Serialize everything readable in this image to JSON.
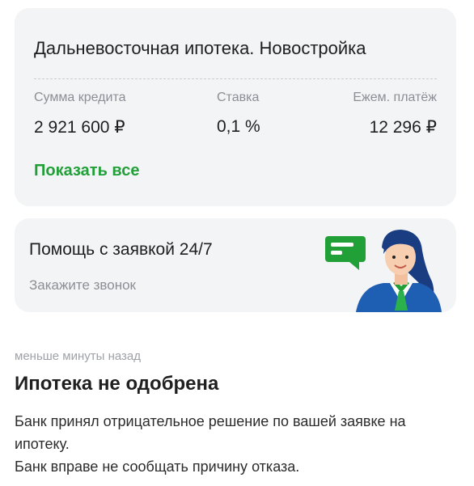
{
  "mortgage": {
    "title": "Дальневосточная ипотека. Новостройка",
    "loan_amount_label": "Сумма кредита",
    "loan_amount": "2 921 600 ₽",
    "rate_label": "Ставка",
    "rate": "0,1 %",
    "payment_label": "Ежем. платёж",
    "payment": "12 296 ₽",
    "show_all": "Показать все"
  },
  "help": {
    "title": "Помощь с заявкой 24/7",
    "subtitle": "Закажите звонок"
  },
  "notification": {
    "time": "меньше минуты назад",
    "title": "Ипотека не одобрена",
    "line1": "Банк принял отрицательное решение по вашей заявке на ипотеку.",
    "line2": "Банк вправе не сообщать причину отказа."
  },
  "colors": {
    "accent_green": "#21a038",
    "card_bg": "#f3f4f6",
    "muted_text": "#8b8f95"
  }
}
